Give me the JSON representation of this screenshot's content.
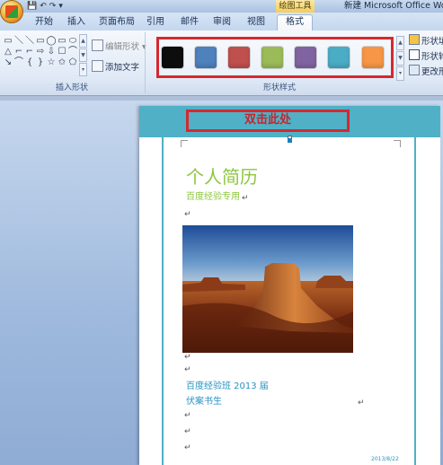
{
  "titlebar": {
    "qat_icons": [
      "save-icon",
      "undo-icon",
      "redo-icon"
    ],
    "contextual_tab": "绘图工具",
    "window_title": "新建 Microsoft Office Word"
  },
  "tabs": [
    {
      "label": "开始"
    },
    {
      "label": "插入"
    },
    {
      "label": "页面布局"
    },
    {
      "label": "引用"
    },
    {
      "label": "邮件"
    },
    {
      "label": "审阅"
    },
    {
      "label": "视图"
    },
    {
      "label": "格式",
      "active": true
    }
  ],
  "ribbon": {
    "insert_shapes": {
      "shapes": [
        "▭",
        "＼",
        "＼",
        "▭",
        "◯",
        "▭",
        "⬭",
        "△",
        "⌐",
        "⌐",
        "⇨",
        "⇩",
        "☐",
        "⌒",
        "↘",
        "⌒",
        "{",
        "}",
        "☆",
        "✩",
        "⬠"
      ],
      "edit_shape_label": "编辑形状 ▾",
      "add_text_label": "添加文字",
      "group_label": "插入形状"
    },
    "shape_styles": {
      "swatches": [
        {
          "name": "black-style",
          "color": "#0d0d0d"
        },
        {
          "name": "blue-style",
          "color": "#4f81bd"
        },
        {
          "name": "red-style",
          "color": "#c0504d"
        },
        {
          "name": "green-style",
          "color": "#9bbb59"
        },
        {
          "name": "purple-style",
          "color": "#8064a2"
        },
        {
          "name": "aqua-style",
          "color": "#4bacc6"
        },
        {
          "name": "orange-style",
          "color": "#f79646"
        }
      ],
      "group_label": "形状样式",
      "fill_label": "形状填",
      "outline_label": "形状轮",
      "change_label": "更改形"
    }
  },
  "document": {
    "header_text": "双击此处",
    "title": "个人简历",
    "subtitle": "百度经验专用",
    "line1": "百度经验班 2013 届",
    "line2": "伏案书生",
    "date": "2013/8/22"
  },
  "colors": {
    "accent_teal": "#4fb0c6",
    "highlight_red": "#d6282f",
    "title_green": "#8dc63f",
    "text_blue": "#2a93c2"
  }
}
